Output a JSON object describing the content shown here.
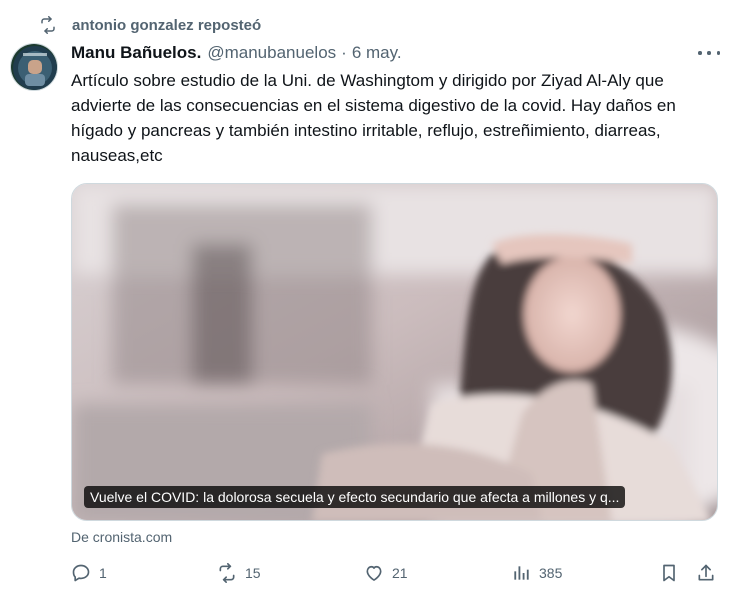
{
  "repost": {
    "icon": "repost-icon",
    "text": "antonio gonzalez reposteó"
  },
  "tweet": {
    "author_name": "Manu Bañuelos.",
    "handle": "@manubanuelos",
    "separator": "·",
    "date": "6 may.",
    "text": "Artículo sobre estudio de la Uni. de Washingtom y dirigido por Ziyad Al-Aly que advierte de las consecuencias en el sistema digestivo de la covid. Hay daños en hígado y pancreas y también intestino irritable, reflujo, estreñimiento, diarreas, nauseas,etc"
  },
  "card": {
    "caption": "Vuelve el COVID: la dolorosa secuela y efecto secundario que afecta a millones y q...",
    "source": "De cronista.com"
  },
  "actions": {
    "replies": "1",
    "reposts": "15",
    "likes": "21",
    "views": "385"
  },
  "colors": {
    "text": "#0f1419",
    "muted": "#536471",
    "border": "#cfd9de"
  }
}
